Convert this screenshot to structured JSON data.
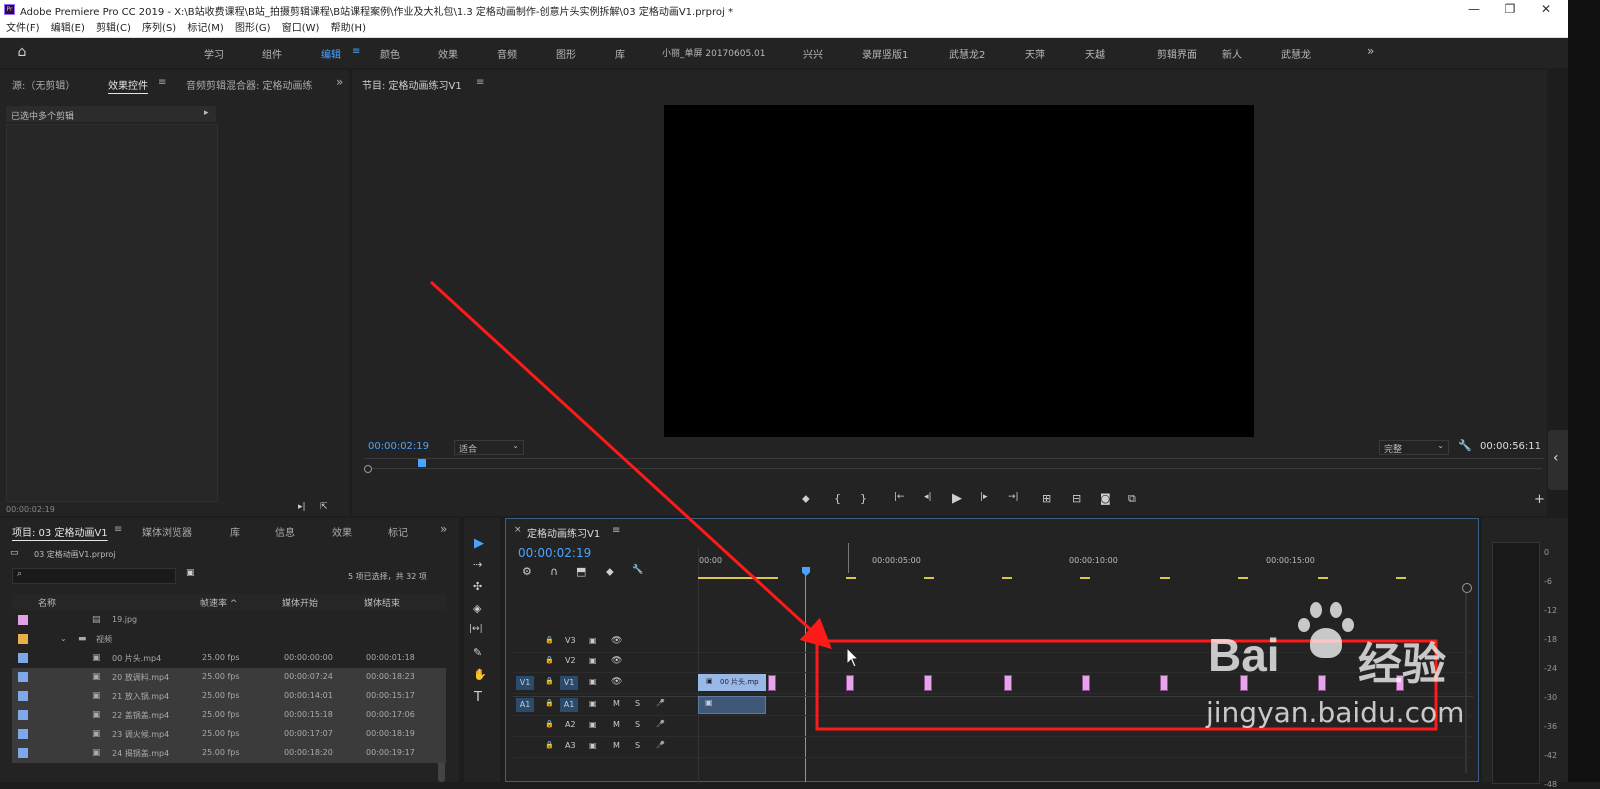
{
  "titlebar": {
    "title": "Adobe Premiere Pro CC 2019 - X:\\B站收费课程\\B站_拍摄剪辑课程\\B站课程案例\\作业及大礼包\\1.3 定格动画制作-创意片头实例拆解\\03 定格动画V1.prproj *",
    "app_icon": "Pr",
    "minimize": "—",
    "restore": "❐",
    "close": "✕"
  },
  "menu": [
    "文件(F)",
    "编辑(E)",
    "剪辑(C)",
    "序列(S)",
    "标记(M)",
    "图形(G)",
    "窗口(W)",
    "帮助(H)"
  ],
  "workspaces": [
    "学习",
    "组件",
    "编辑",
    "颜色",
    "效果",
    "音频",
    "图形",
    "库",
    "小丽_单屏 20170605.01",
    "兴兴",
    "录屏竖版1",
    "武慧龙2",
    "天萍",
    "天越",
    "剪辑界面",
    "新人",
    "武慧龙"
  ],
  "workspace_active": "编辑",
  "workspace_menu_icon": "≡",
  "more_icon": "»",
  "source_panel": {
    "tabs": [
      "源:（无剪辑）",
      "效果控件",
      "音频剪辑混合器: 定格动画练"
    ],
    "active_tab": "效果控件",
    "menu_icon": "≡",
    "header_text": "已选中多个剪辑",
    "expand_icon": "▸",
    "timecode": "00:00:02:19"
  },
  "program_monitor": {
    "title": "节目: 定格动画练习V1",
    "menu_icon": "≡",
    "timecode": "00:00:02:19",
    "fit": "适合",
    "quality": "完整",
    "duration": "00:00:56:11",
    "transport": [
      "⬥",
      "{",
      "}",
      "|←",
      "◂|",
      "▶",
      "|▸",
      "→|",
      "⊞",
      "⊟",
      "◙",
      "⧉"
    ],
    "add_button": "+"
  },
  "project_panel": {
    "tabs": [
      "项目: 03 定格动画V1",
      "媒体浏览器",
      "库",
      "信息",
      "效果",
      "标记"
    ],
    "active_tab": "项目: 03 定格动画V1",
    "menu_icon": "≡",
    "more_icon": "»",
    "project_file": "03 定格动画V1.prproj",
    "selection_info": "5 项已选择，共 32 项",
    "columns": [
      "名称",
      "帧速率 ^",
      "媒体开始",
      "媒体结束"
    ],
    "rows": [
      {
        "name": "19.jpg",
        "fps": "",
        "start": "",
        "end": "",
        "color": "#e3a0e6",
        "selected": false,
        "indent": 2,
        "icon": "file"
      },
      {
        "name": "视频",
        "fps": "",
        "start": "",
        "end": "",
        "color": "#e8b04a",
        "selected": false,
        "indent": 1,
        "icon": "folder"
      },
      {
        "name": "00 片头.mp4",
        "fps": "25.00 fps",
        "start": "00:00:00:00",
        "end": "00:00:01:18",
        "color": "#7fa8e8",
        "selected": false,
        "indent": 2,
        "icon": "clip"
      },
      {
        "name": "20 放调料.mp4",
        "fps": "25.00 fps",
        "start": "00:00:07:24",
        "end": "00:00:18:23",
        "color": "#7fa8e8",
        "selected": true,
        "indent": 2,
        "icon": "clip"
      },
      {
        "name": "21 放入锅.mp4",
        "fps": "25.00 fps",
        "start": "00:00:14:01",
        "end": "00:00:15:17",
        "color": "#7fa8e8",
        "selected": true,
        "indent": 2,
        "icon": "clip"
      },
      {
        "name": "22 盖锅盖.mp4",
        "fps": "25.00 fps",
        "start": "00:00:15:18",
        "end": "00:00:17:06",
        "color": "#7fa8e8",
        "selected": true,
        "indent": 2,
        "icon": "clip"
      },
      {
        "name": "23 调火候.mp4",
        "fps": "25.00 fps",
        "start": "00:00:17:07",
        "end": "00:00:18:19",
        "color": "#7fa8e8",
        "selected": true,
        "indent": 2,
        "icon": "clip"
      },
      {
        "name": "24 揭锅盖.mp4",
        "fps": "25.00 fps",
        "start": "00:00:18:20",
        "end": "00:00:19:17",
        "color": "#7fa8e8",
        "selected": true,
        "indent": 2,
        "icon": "clip"
      }
    ]
  },
  "tools": [
    "▶",
    "⇢",
    "✣",
    "◈",
    "|↔|",
    "✎",
    "✋",
    "T"
  ],
  "timeline": {
    "title": "定格动画练习V1",
    "close_icon": "×",
    "menu_icon": "≡",
    "timecode": "00:00:02:19",
    "ruler": [
      "00:00",
      "00:00:05:00",
      "00:00:10:00",
      "00:00:15:00"
    ],
    "tracks": [
      {
        "source": "",
        "name": "V3",
        "type": "video"
      },
      {
        "source": "",
        "name": "V2",
        "type": "video"
      },
      {
        "source": "V1",
        "name": "V1",
        "type": "video"
      },
      {
        "source": "A1",
        "name": "A1",
        "type": "audio"
      },
      {
        "source": "",
        "name": "A2",
        "type": "audio"
      },
      {
        "source": "",
        "name": "A3",
        "type": "audio"
      }
    ],
    "clip_label": "00 片头.mp",
    "track_m": "M",
    "track_s": "S",
    "mini_icons": [
      "⚙",
      "∩",
      "⬒",
      "⬥",
      "🔧"
    ]
  },
  "meter": {
    "labels": [
      "0",
      "-6",
      "-12",
      "-18",
      "-24",
      "-30",
      "-36",
      "-42",
      "-48"
    ]
  },
  "watermark": {
    "brand": "Bai",
    "mid": "经验",
    "site": "jingyan.baidu.com"
  },
  "colors": {
    "accent": "#4aa3ff",
    "highlight": "#ff1a1a",
    "keyframe": "#e7a4ea"
  }
}
